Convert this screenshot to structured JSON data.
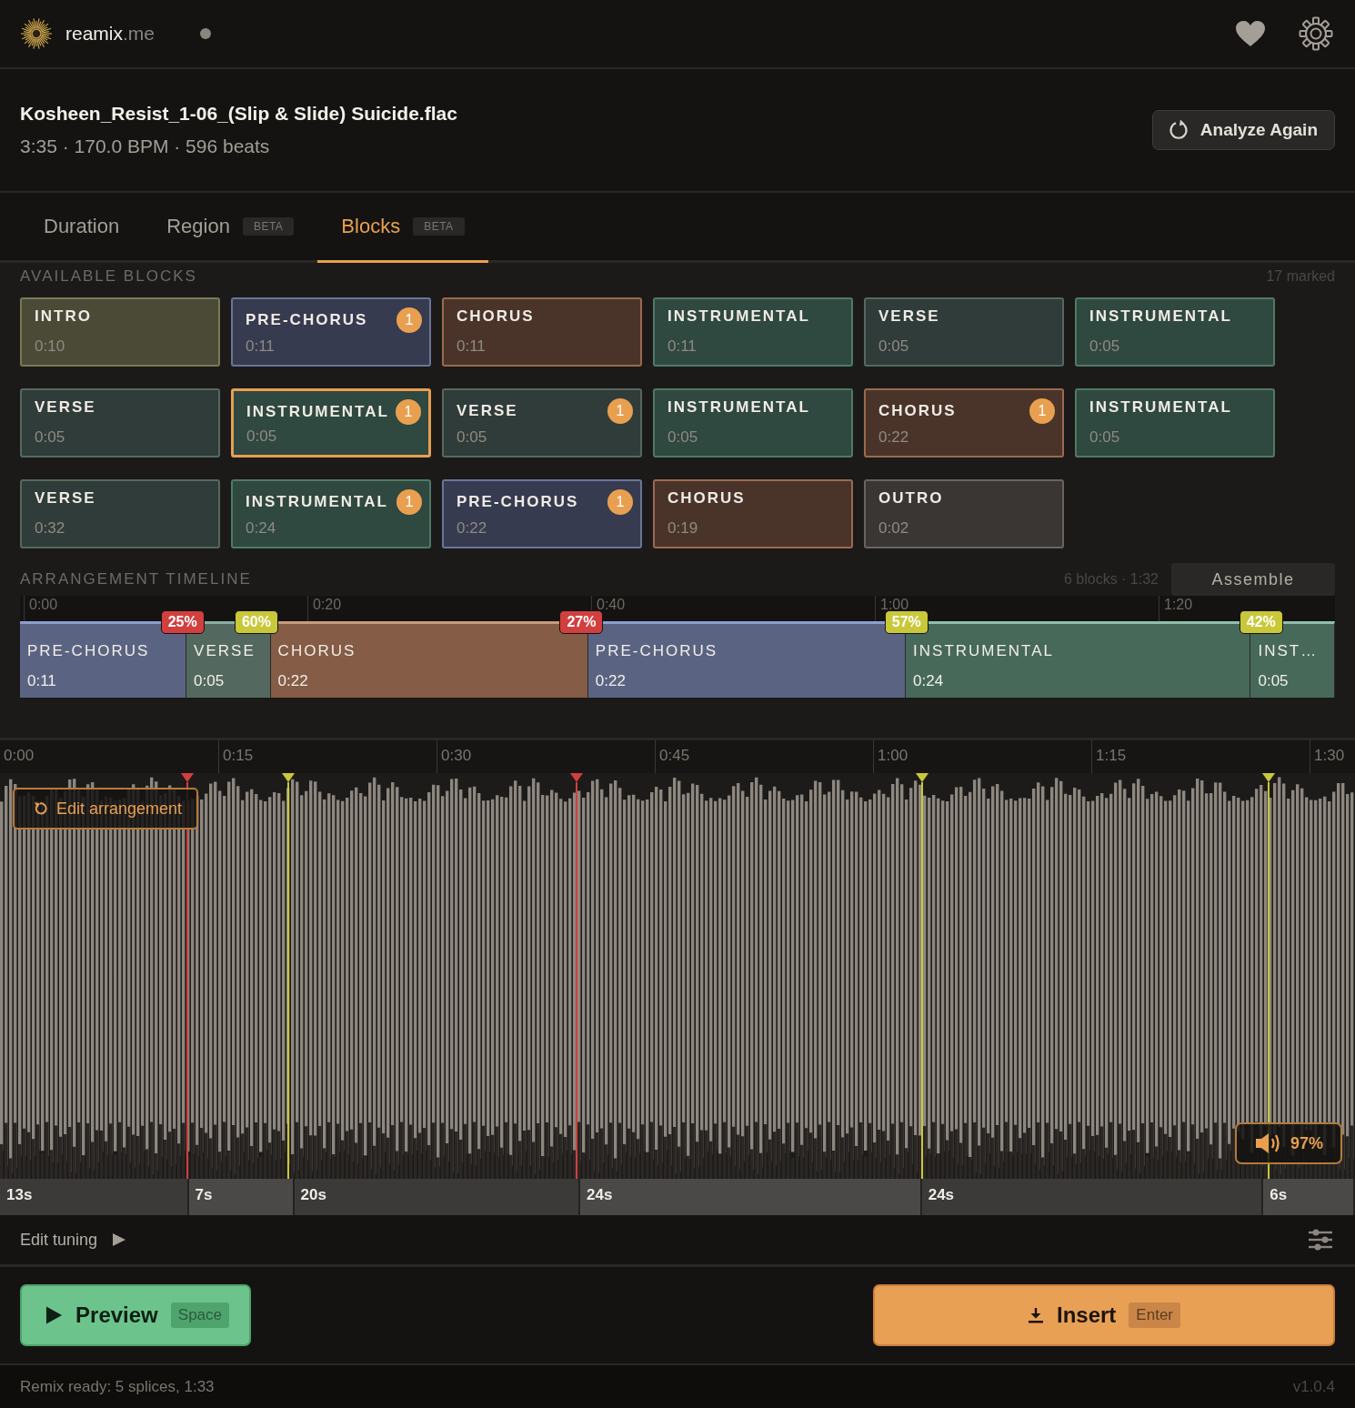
{
  "app": {
    "brand": "reamix",
    "brand_suffix": ".me"
  },
  "file": {
    "name": "Kosheen_Resist_1-06_(Slip & Slide) Suicide.flac",
    "meta": "3:35 · 170.0 BPM · 596 beats",
    "analyze_button": "Analyze Again"
  },
  "tabs": [
    {
      "label": "Duration",
      "selected": false
    },
    {
      "label": "Region",
      "badge": "BETA",
      "selected": false
    },
    {
      "label": "Blocks",
      "badge": "BETA",
      "selected": true
    }
  ],
  "available_blocks": {
    "title": "AVAILABLE BLOCKS",
    "count": "17 marked",
    "blocks": [
      {
        "kind": "intro",
        "label": "INTRO",
        "duration": "0:10",
        "selected": false
      },
      {
        "kind": "pre-chorus",
        "label": "PRE-CHORUS",
        "duration": "0:11",
        "badge": "1",
        "selected": false
      },
      {
        "kind": "chorus",
        "label": "CHORUS",
        "duration": "0:11",
        "selected": false
      },
      {
        "kind": "instrumental",
        "label": "INSTRUMENTAL",
        "duration": "0:11",
        "selected": false
      },
      {
        "kind": "verse",
        "label": "VERSE",
        "duration": "0:05",
        "selected": false
      },
      {
        "kind": "instrumental",
        "label": "INSTRUMENTAL",
        "duration": "0:05",
        "selected": false
      },
      {
        "kind": "verse",
        "label": "VERSE",
        "duration": "0:05",
        "selected": false
      },
      {
        "kind": "instrumental",
        "label": "INSTRUMENTAL",
        "duration": "0:05",
        "badge": "1",
        "selected": true
      },
      {
        "kind": "verse",
        "label": "VERSE",
        "duration": "0:05",
        "badge": "1",
        "selected": false
      },
      {
        "kind": "instrumental",
        "label": "INSTRUMENTAL",
        "duration": "0:05",
        "selected": false
      },
      {
        "kind": "chorus",
        "label": "CHORUS",
        "duration": "0:22",
        "badge": "1",
        "selected": false
      },
      {
        "kind": "instrumental",
        "label": "INSTRUMENTAL",
        "duration": "0:05",
        "selected": false
      },
      {
        "kind": "verse",
        "label": "VERSE",
        "duration": "0:32",
        "selected": false
      },
      {
        "kind": "instrumental",
        "label": "INSTRUMENTAL",
        "duration": "0:24",
        "badge": "1",
        "selected": false
      },
      {
        "kind": "pre-chorus",
        "label": "PRE-CHORUS",
        "duration": "0:22",
        "badge": "1",
        "selected": false
      },
      {
        "kind": "chorus",
        "label": "CHORUS",
        "duration": "0:19",
        "selected": false
      },
      {
        "kind": "outro",
        "label": "OUTRO",
        "duration": "0:02",
        "selected": false
      }
    ]
  },
  "arrangement": {
    "title": "ARRANGEMENT TIMELINE",
    "summary": "6 blocks · 1:32",
    "assemble_button": "Assemble",
    "ruler": [
      "0:00",
      "0:20",
      "0:40",
      "1:00",
      "1:20"
    ],
    "blocks": [
      {
        "kind": "pre-chorus",
        "label": "PRE-CHORUS",
        "duration": "0:11"
      },
      {
        "kind": "verse",
        "label": "VERSE",
        "duration": "0:05"
      },
      {
        "kind": "chorus",
        "label": "CHORUS",
        "duration": "0:22"
      },
      {
        "kind": "pre-chorus",
        "label": "PRE-CHORUS",
        "duration": "0:22"
      },
      {
        "kind": "instrumental",
        "label": "INSTRUMENTAL",
        "duration": "0:24"
      },
      {
        "kind": "instrumental",
        "label": "INST…",
        "duration": "0:05"
      }
    ],
    "splices": [
      {
        "label": "25%",
        "color": "#d23f3f"
      },
      {
        "label": "60%",
        "color": "#c8c83a"
      },
      {
        "label": "27%",
        "color": "#d23f3f"
      },
      {
        "label": "57%",
        "color": "#c8c83a"
      },
      {
        "label": "42%",
        "color": "#c8c83a"
      }
    ]
  },
  "waveform": {
    "ruler": [
      "0:00",
      "0:15",
      "0:30",
      "0:45",
      "1:00",
      "1:15",
      "1:30"
    ],
    "edit_button": "Edit arrangement",
    "volume": "97%",
    "segments": [
      "13s",
      "7s",
      "20s",
      "24s",
      "24s",
      "6s"
    ]
  },
  "tuning": {
    "label": "Edit tuning"
  },
  "actions": {
    "preview": {
      "label": "Preview",
      "key": "Space"
    },
    "insert": {
      "label": "Insert",
      "key": "Enter"
    }
  },
  "status_bar": {
    "message": "Remix ready: 5 splices, 1:33",
    "version": "v1.0.4"
  }
}
